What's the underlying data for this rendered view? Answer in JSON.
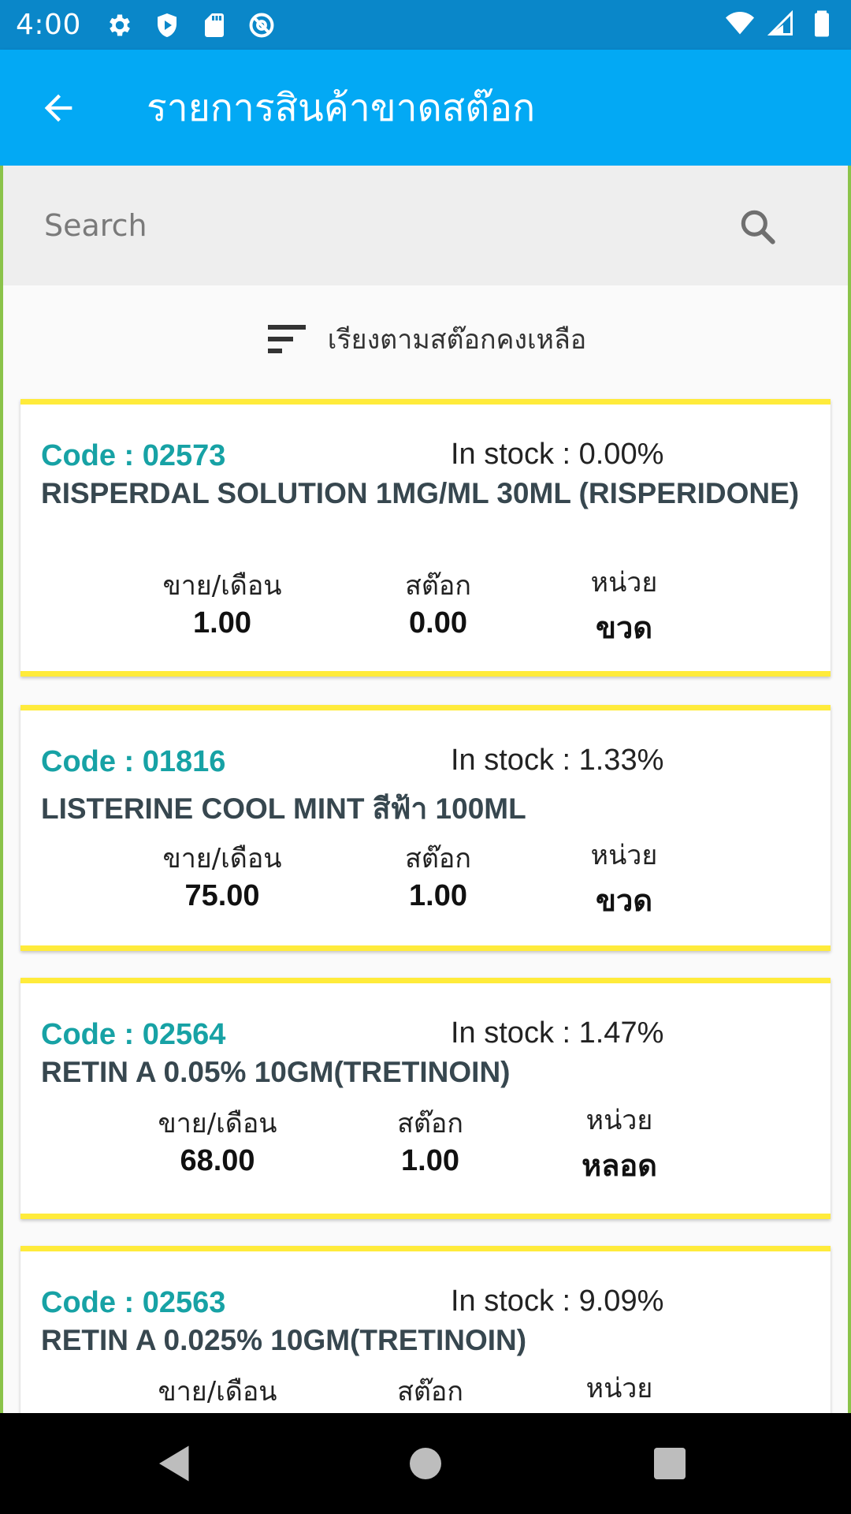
{
  "status_bar": {
    "time": "4:00",
    "left_icons": [
      "settings-icon",
      "shield-icon",
      "sd-card-icon",
      "at-sign-icon"
    ],
    "right_icons": [
      "wifi-icon",
      "cell-signal-icon",
      "battery-icon"
    ]
  },
  "app_bar": {
    "title": "รายการสินค้าขาดสต๊อก",
    "back_icon": "arrow-left-icon",
    "color": "#03a9f4"
  },
  "search": {
    "placeholder": "Search",
    "value": "",
    "icon": "search-icon"
  },
  "sort": {
    "label": "เรียงตามสต๊อกคงเหลือ",
    "icon": "sort-icon"
  },
  "columns": {
    "sales_label": "ขาย/เดือน",
    "stock_label": "สต๊อก",
    "unit_label": "หน่วย"
  },
  "items": [
    {
      "code": "Code : 02573",
      "in_stock": "In stock : 0.00%",
      "name": "RISPERDAL SOLUTION 1MG/ML  30ML (RISPERIDONE)",
      "sales": "1.00",
      "stock": "0.00",
      "unit": "ขวด"
    },
    {
      "code": "Code : 01816",
      "in_stock": "In stock : 1.33%",
      "name": "LISTERINE COOL MINT สีฟ้า 100ML",
      "sales": "75.00",
      "stock": "1.00",
      "unit": "ขวด"
    },
    {
      "code": "Code : 02564",
      "in_stock": "In stock : 1.47%",
      "name": "RETIN A 0.05% 10GM(TRETINOIN)",
      "sales": "68.00",
      "stock": "1.00",
      "unit": "หลอด"
    },
    {
      "code": "Code : 02563",
      "in_stock": "In stock : 9.09%",
      "name": "RETIN A 0.025% 10GM(TRETINOIN)",
      "sales": "",
      "stock": "",
      "unit": ""
    }
  ],
  "nav_bar": {
    "icons": [
      "back-triangle-icon",
      "home-circle-icon",
      "recents-square-icon"
    ]
  },
  "colors": {
    "accent": "#03a9f4",
    "status_bar": "#0a87c9",
    "card_border": "#ffeb3b",
    "code_text": "#17a2a5",
    "frame": "#8bc34a"
  }
}
